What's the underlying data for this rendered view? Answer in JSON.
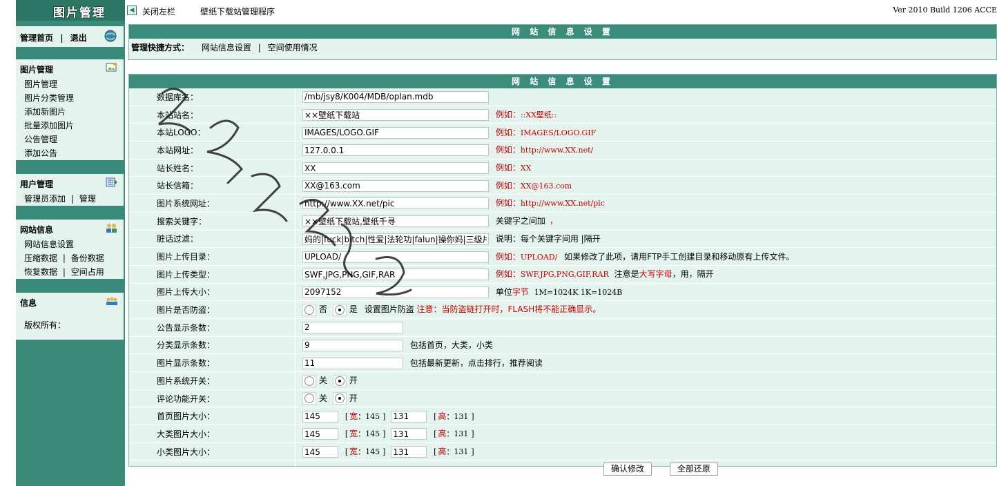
{
  "sidebar": {
    "logo_title": "图片管理",
    "nav": {
      "home": "管理首页",
      "sep": "|",
      "logout": "退出"
    },
    "sections": [
      {
        "title": "图片管理",
        "icon": "image-edit-icon",
        "items": [
          "图片管理",
          "图片分类管理",
          "添加新图片",
          "批量添加图片",
          "公告管理",
          "添加公告"
        ]
      },
      {
        "title": "用户管理",
        "icon": "user-list-icon",
        "items_inline": [
          {
            "a": "管理员添加",
            "b": "管理"
          }
        ]
      },
      {
        "title": "网站信息",
        "icon": "users-group-icon",
        "items": [
          "网站信息设置"
        ],
        "items_inline": [
          {
            "a": "压缩数据",
            "b": "备份数据"
          },
          {
            "a": "恢复数据",
            "b": "空间占用"
          }
        ]
      },
      {
        "title": "信息",
        "icon": "team-icon",
        "body": "版权所有："
      }
    ]
  },
  "topbar": {
    "close_sidebar": "关闭左栏",
    "app_title": "壁纸下载站管理程序",
    "version": "Ver 2010 Build 1206 ACCE"
  },
  "quick_panel": {
    "header": "网 站 信 息 设 置",
    "label": "管理快捷方式：",
    "link1": "网站信息设置",
    "sep": "|",
    "link2": "空间使用情况"
  },
  "settings": {
    "header": "网 站 信 息 设 置",
    "rows": {
      "db": {
        "label": "数据库名：",
        "value": "/mb/jsy8/K004/MDB/oplan.mdb"
      },
      "site_name": {
        "label": "本站站名：",
        "value": "××壁纸下载站",
        "example_prefix": "例如：",
        "example": "::XX壁纸::"
      },
      "logo": {
        "label": "本站LOGO：",
        "value": "IMAGES/LOGO.GIF",
        "example_prefix": "例如：",
        "example": "IMAGES/LOGO.GIF"
      },
      "url": {
        "label": "本站网址：",
        "value": "127.0.0.1",
        "example_prefix": "例如：",
        "example": "http://www.XX.net/"
      },
      "admin": {
        "label": "站长姓名：",
        "value": "XX",
        "example_prefix": "例如：",
        "example": "XX"
      },
      "email": {
        "label": "站长信箱：",
        "value": "XX@163.com",
        "example_prefix": "例如：",
        "example": "XX@163.com"
      },
      "img_url": {
        "label": "图片系统网址：",
        "value": "http://www.XX.net/pic",
        "example_prefix": "例如：",
        "example": "http://www.XX.net/pic"
      },
      "keywords": {
        "label": "搜索关键字：",
        "value": "××壁纸下载站,壁纸千寻",
        "note": "关键字之间加",
        "note_red": "，"
      },
      "filter": {
        "label": "脏话过滤：",
        "value": "妈的|fuck|bitch|性爱|法轮功|falun|操你妈|三级片",
        "note": "说明：每个关键字间用 |隔开"
      },
      "upload_dir": {
        "label": "图片上传目录：",
        "value": "UPLOAD/",
        "example_prefix": "例如：",
        "example": "UPLOAD/",
        "note": "如果修改了此项，请用FTP手工创建目录和移动原有上传文件。"
      },
      "upload_type": {
        "label": "图片上传类型：",
        "value": "SWF,JPG,PNG,GIF,RAR",
        "example_prefix": "例如：",
        "example": "SWF,JPG,PNG,GIF,RAR",
        "note1": "注意是",
        "note_red": "大写字母",
        "note2": "，用，隔开"
      },
      "upload_size": {
        "label": "图片上传大小：",
        "value": "2097152",
        "note1": "单位",
        "note_red": "字节",
        "note2": "1M=1024K 1K=1024B"
      },
      "anti_leech": {
        "label": "图片是否防盗：",
        "opt_no": "否",
        "opt_yes": "是",
        "note": "设置图片防盗",
        "warn": "注意：当防盗链打开时，FLASH将不能正确显示。"
      },
      "notice_cnt": {
        "label": "公告显示条数：",
        "value": "2"
      },
      "cat_cnt": {
        "label": "分类显示条数：",
        "value": "9",
        "note": "包括首页，大类，小类"
      },
      "img_cnt": {
        "label": "图片显示条数：",
        "value": "11",
        "note": "包括最新更新，点击排行，推荐阅读"
      },
      "sys_switch": {
        "label": "图片系统开关：",
        "opt_off": "关",
        "opt_on": "开"
      },
      "cmt_switch": {
        "label": "评论功能开关：",
        "opt_off": "关",
        "opt_on": "开"
      },
      "home_size": {
        "label": "首页图片大小：",
        "w": "145",
        "h": "131",
        "w_lbl": "宽",
        "h_lbl": "高",
        "w_val": "145",
        "h_val": "131"
      },
      "big_size": {
        "label": "大类图片大小：",
        "w": "145",
        "h": "131",
        "w_lbl": "宽",
        "h_lbl": "高",
        "w_val": "145",
        "h_val": "131"
      },
      "small_size": {
        "label": "小类图片大小：",
        "w": "145",
        "h": "131",
        "w_lbl": "宽",
        "h_lbl": "高",
        "w_val": "145",
        "h_val": "131"
      }
    },
    "buttons": {
      "submit": "确认修改",
      "reset": "全部还原"
    }
  },
  "colors": {
    "sidebar": "#3a8a79",
    "header": "#3c8c7b",
    "panel_bg": "#e4f3ee",
    "red": "#c00000"
  }
}
